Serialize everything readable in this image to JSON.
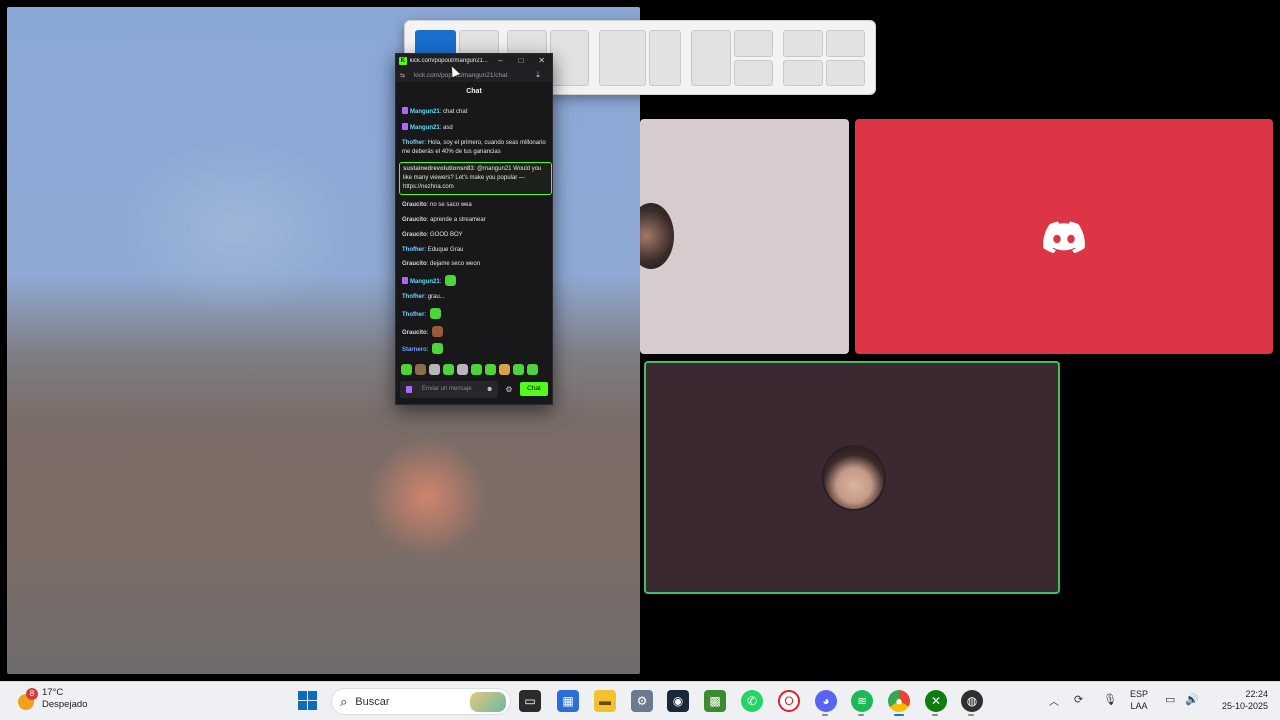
{
  "chat_window": {
    "title": "kick.com/popout/mangun21...",
    "url": "kick.com/popout/mangun21/chat",
    "header": "Chat",
    "controls": {
      "minimize": "–",
      "maximize": "□",
      "close": "✕"
    },
    "messages": [
      {
        "user": "Mangun21",
        "color": "#53e0ff",
        "text": "chat chat",
        "badge": true
      },
      {
        "user": "Mangun21",
        "color": "#53e0ff",
        "text": "asd",
        "badge": true
      },
      {
        "user": "Thofher",
        "color": "#6ed0ff",
        "text": "Hola, soy el primero, cuando seas millonario me deberás el 40% de tus ganancias"
      },
      {
        "user": "sustainedrevolutionsn83",
        "color": "#c0c0c0",
        "text": "@mangun21 Would you like many viewers? Let's make you popular — https://nezhna.com",
        "highlight": true
      },
      {
        "user": "Graucito",
        "color": "#d6d6d6",
        "text": "no se saco wea"
      },
      {
        "user": "Graucito",
        "color": "#d6d6d6",
        "text": "aprende a streamear"
      },
      {
        "user": "Graucito",
        "color": "#d6d6d6",
        "text": "GOOD BOY"
      },
      {
        "user": "Thofher",
        "color": "#6ed0ff",
        "text": "Eduque Grau"
      },
      {
        "user": "Graucito",
        "color": "#d6d6d6",
        "text": "dejame seco weon"
      },
      {
        "user": "Mangun21",
        "color": "#53e0ff",
        "text": "",
        "badge": true,
        "emote": "green"
      },
      {
        "user": "Thofher",
        "color": "#6ed0ff",
        "text": "grau..."
      },
      {
        "user": "Thofher",
        "color": "#6ed0ff",
        "text": "",
        "emote": "green"
      },
      {
        "user": "Graucito",
        "color": "#d6d6d6",
        "text": "",
        "emote": "brown"
      },
      {
        "user": "Starnero",
        "color": "#6aa0ff",
        "text": "",
        "emote": "green"
      }
    ],
    "input_placeholder": "Enviar un mensaje",
    "send_label": "Chat"
  },
  "taskbar": {
    "weather_badge": "8",
    "temperature": "17°C",
    "condition": "Despejado",
    "search_label": "Buscar",
    "language_line1": "ESP",
    "language_line2": "LAA",
    "time": "22:24",
    "date": "25-10-2025",
    "apps": [
      "task-view",
      "microsoft-store",
      "file-explorer",
      "settings",
      "steam",
      "minecraft",
      "whatsapp",
      "opera",
      "discord",
      "spotify",
      "chrome",
      "xbox",
      "obs"
    ]
  },
  "colors": {
    "kick_green": "#53fc18",
    "discord_tile": "#dc3545",
    "cam_border": "#3fbf5f"
  }
}
